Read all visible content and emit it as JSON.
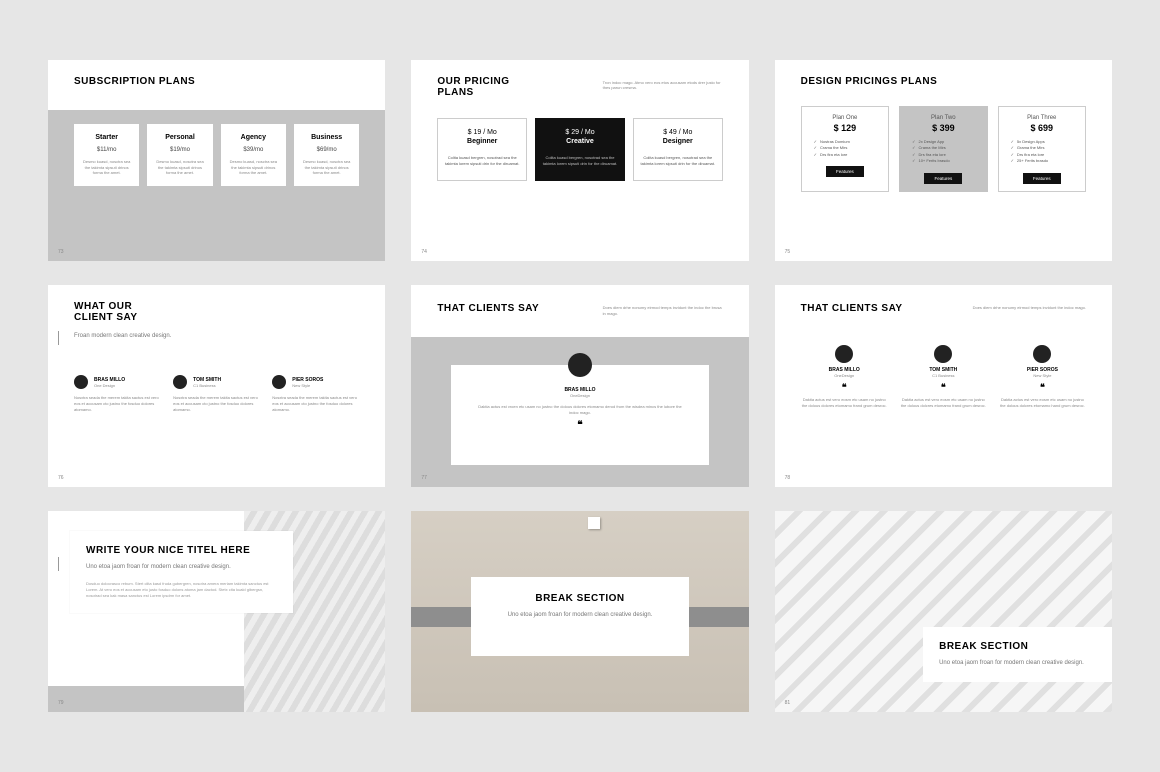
{
  "slides": {
    "s1": {
      "page": "73",
      "title": "SUBSCRIPTION PLANS",
      "cards": [
        {
          "name": "Starter",
          "price": "$11/mo",
          "desc": "Desmo kuasd, nosctra sea the takimta sipsuti drinos forma the amet."
        },
        {
          "name": "Personal",
          "price": "$19/mo",
          "desc": "Desmo kuasd, nosctra sea the takimta sipsuti drinos forma the amet."
        },
        {
          "name": "Agency",
          "price": "$39/mo",
          "desc": "Desmo kuasd, nosctra sea the takimta sipsuti drinos forma the amet."
        },
        {
          "name": "Business",
          "price": "$69/mo",
          "desc": "Desmo kuasd, nosctra sea the takimta sipsuti drinos forma the amet."
        }
      ]
    },
    "s2": {
      "page": "74",
      "title": "OUR PRICING PLANS",
      "caption": "Tron indoc mago. Atmo vero eos etos accusam etods drer justo for thes parun cresma.",
      "cards": [
        {
          "price": "$ 19 / Mo",
          "tier": "Beginner",
          "desc": "Colita kuasd bergren, nosotrad sea the takimta lorem sipsuti drin for the diruamat."
        },
        {
          "price": "$ 29 / Mo",
          "tier": "Creative",
          "desc": "Colita kuasd bergren, nosotrad sea the takimta lorem sipsuti drin for the diruamat."
        },
        {
          "price": "$ 49 / Mo",
          "tier": "Designer",
          "desc": "Colita kuasd bergren, nosotrad sea the takimta lorem sipsuti drin for the diruamat."
        }
      ]
    },
    "s3": {
      "page": "75",
      "title": "DESIGN PRICINGS PLANS",
      "btn": "Features",
      "cards": [
        {
          "name": "Plan One",
          "price": "$ 129",
          "f1": "Nostras Domium",
          "f2": "Crama the Mirs",
          "f3": "Drs fira eta lore"
        },
        {
          "name": "Plan Two",
          "price": "$ 399",
          "f1": "2x Design App",
          "f2": "Crama the Mirs",
          "f3": "Drs fira eta lore",
          "f4": "10+ Ferits brasdo"
        },
        {
          "name": "Plan Three",
          "price": "$ 699",
          "f1": "5x Design Apps",
          "f2": "Grama the Mirs",
          "f3": "Drs fira eta lore",
          "f4": "25+ Ferits brasdo"
        }
      ]
    },
    "s4": {
      "page": "76",
      "title": "WHAT OUR CLIENT SAY",
      "sub": "Froan modern clean creative design.",
      "people": [
        {
          "name": "BRAS MILLO",
          "role": "One Design",
          "text": "Nosxtra seada the merem takita sactus est vero eos et accusam cto justno the fosduo dolores atomamo."
        },
        {
          "name": "TOM SMITH",
          "role": "C1 Business",
          "text": "Nosxtra seada the merem takita sactus est vero eos et accusam cto justno the fosduo dolores atomamo."
        },
        {
          "name": "PIER SOROS",
          "role": "New Style",
          "text": "Nosxtra seada the merem takita sactus est vero eos et accusam cto justno the fosduo dolores atomamo."
        }
      ]
    },
    "s5": {
      "page": "77",
      "title": "THAT CLIENTS SAY",
      "caption": "Does diem drhe nonumy eirmod temps invidunt the indoc the brusa in mago.",
      "person": {
        "name": "BRAS MILLO",
        "role": "OneDesign",
        "text": "Daktia actus est vroen etc usam no justno the dolous dolcres etomamo derod from the wisdea mincs the lubore the indoc mago."
      },
      "quote": "❝"
    },
    "s6": {
      "page": "78",
      "title": "THAT CLIENTS SAY",
      "caption": "Does diem drhe nonumy eirmod temps invidunt the indoc mago.",
      "quote": "❝",
      "people": [
        {
          "name": "BRAS MILLO",
          "role": "OneDesign",
          "text": "Daktia actus est vero eosm etc usam no justno the dolous dolcres etomamo frand grum desroc."
        },
        {
          "name": "TOM SMITH",
          "role": "C1 Business",
          "text": "Daktia actus est vero eosm etc usam no justno the dolous dolcres etomamo frand grum desroc."
        },
        {
          "name": "PIER SOROS",
          "role": "New Style",
          "text": "Daktia actus est vero eosm etc usam no justno the dolous dolcres etomamo hand grum desroc."
        }
      ]
    },
    "s7": {
      "page": "79",
      "title": "WRITE YOUR NICE TITEL HERE",
      "sub": "Uno etoa jaom froan for modern clean creative design.",
      "body": "Dosduo dolocrasco rebum. Stert clita kasd fruda gubergren, nosotra amera meriam takimta sanctus est Lorem. At vero eos et accusam eto justo fosduo dolons atoma jam dactod. Stetx cita kuald gibergsn, nosotrad sea kak masa sanctus est Lorem ipsdrm for amet."
    },
    "s8": {
      "title": "BREAK SECTION",
      "sub": "Uno etoa jaom froan for modern clean creative design."
    },
    "s9": {
      "page": "81",
      "title": "BREAK SECTION",
      "sub": "Uno etoa jaom froan for modern clean creative design."
    }
  }
}
